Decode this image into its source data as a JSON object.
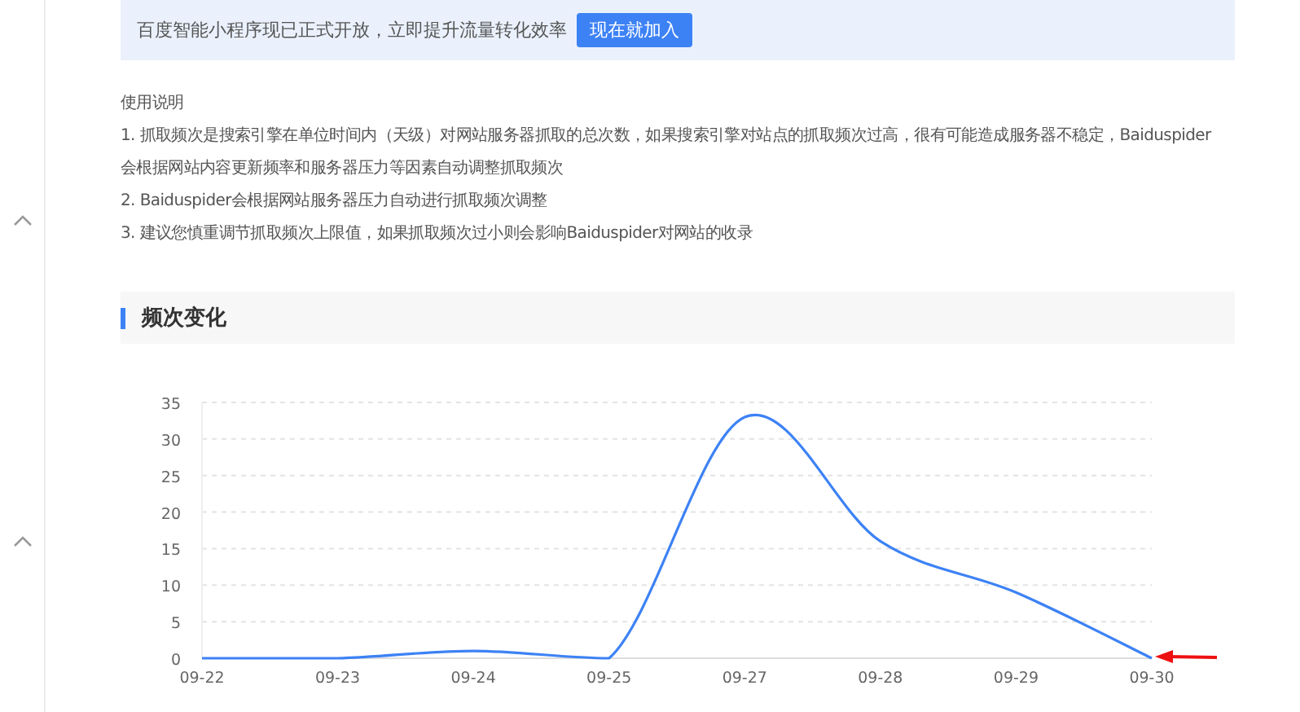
{
  "banner": {
    "text": "百度智能小程序现已正式开放，立即提升流量转化效率",
    "button": "现在就加入"
  },
  "instructions": {
    "title": "使用说明",
    "items": [
      "1. 抓取频次是搜索引擎在单位时间内（天级）对网站服务器抓取的总次数，如果搜索引擎对站点的抓取频次过高，很有可能造成服务器不稳定，Baiduspider",
      "会根据网站内容更新频率和服务器压力等因素自动调整抓取频次",
      "2. Baiduspider会根据网站服务器压力自动进行抓取频次调整",
      "3. 建议您慎重调节抓取频次上限值，如果抓取频次过小则会影响Baiduspider对网站的收录"
    ]
  },
  "sidebar": {
    "toggles": [
      {
        "expanded": false
      },
      {
        "expanded": false
      }
    ]
  },
  "section": {
    "title": "频次变化",
    "chart_data": {
      "type": "line",
      "categories": [
        "09-22",
        "09-23",
        "09-24",
        "09-25",
        "09-27",
        "09-28",
        "09-29",
        "09-30"
      ],
      "series": [
        {
          "color": "#3d82f5",
          "values": [
            0,
            0,
            1,
            0,
            33,
            16,
            9,
            0
          ]
        }
      ],
      "ylim": [
        0,
        35
      ],
      "yticks": [
        0,
        5,
        10,
        15,
        20,
        25,
        30,
        35
      ],
      "grid": true
    }
  }
}
